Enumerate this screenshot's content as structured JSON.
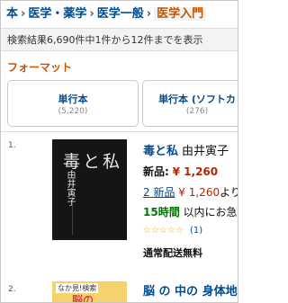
{
  "breadcrumb": {
    "items": [
      "本",
      "医学・薬学",
      "医学一般"
    ],
    "current": "医学入門",
    "separator": "›"
  },
  "results": {
    "count_text": "検索結果6,690件中1件から12件までを表示"
  },
  "format": {
    "title": "フォーマット",
    "options": [
      {
        "label": "単行本",
        "count": "(5,220)"
      },
      {
        "label": "単行本 (ソフトカ",
        "count": "(276)"
      }
    ]
  },
  "products": [
    {
      "index": "1.",
      "cover_title": "毒と私",
      "cover_author": "由井寅子",
      "title": "毒と私",
      "author": "由井寅子",
      "price_label": "新品:",
      "price": "¥ 1,260",
      "new_link": "2 新品",
      "new_price": "¥ 1,260",
      "new_suffix": "より",
      "ship_hours": "15時間",
      "ship_text": "以内にお急",
      "stars": "☆☆☆☆☆",
      "rating_count": "(1)",
      "free_shipping": "通常配送無料"
    },
    {
      "index": "2.",
      "cover_badge": "なか見!検索",
      "cover_text": "脳の",
      "title": "脳 の 中の 身体地"
    }
  ],
  "colors": {
    "link": "#004b91",
    "price": "#b12704",
    "accent": "#c45500",
    "ship": "#007600",
    "star": "#f4a81d"
  }
}
